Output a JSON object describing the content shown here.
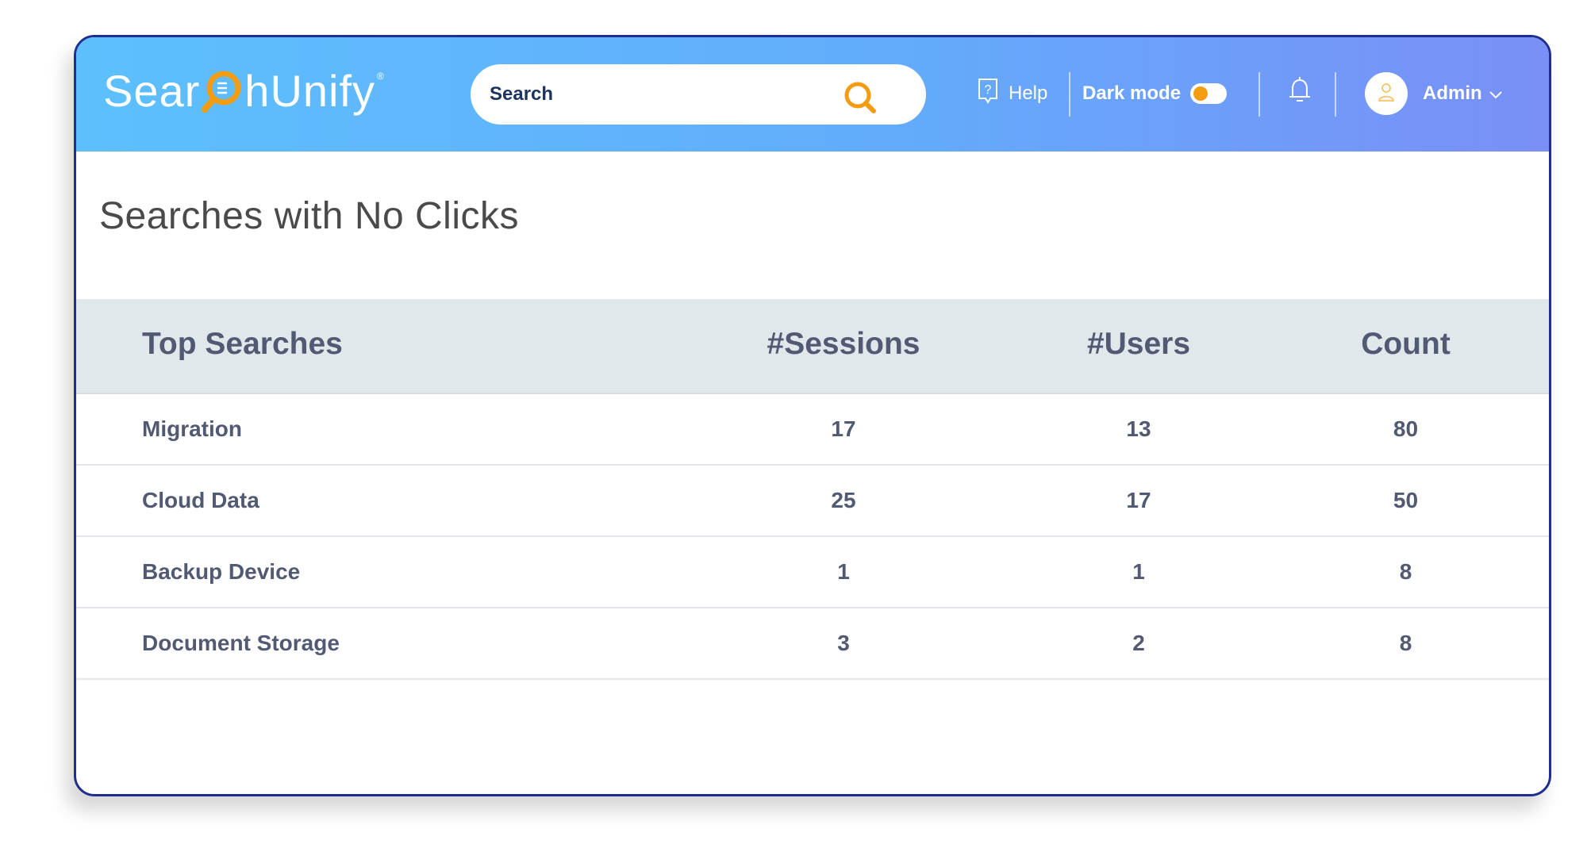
{
  "app": {
    "logo_text_before": "Sear",
    "logo_text_after": "hUnify",
    "logo_reg": "®"
  },
  "header": {
    "search_placeholder": "Search",
    "help_label": "Help",
    "dark_mode_label": "Dark mode",
    "dark_mode_enabled": false,
    "user_label": "Admin"
  },
  "icons": {
    "search": "search-icon",
    "help": "help-icon",
    "bell": "bell-icon",
    "user": "user-icon",
    "chevron": "chevron-down-icon"
  },
  "colors": {
    "header_gradient_start": "#5dc0fd",
    "header_gradient_end": "#7a8ff7",
    "accent_orange": "#f39c12",
    "card_border": "#1e2f8f",
    "table_header_bg": "#e1e8ec",
    "text_primary": "#525a73"
  },
  "page": {
    "title": "Searches with No Clicks"
  },
  "table": {
    "columns": [
      "Top Searches",
      "#Sessions",
      "#Users",
      "Count"
    ],
    "rows": [
      {
        "search": "Migration",
        "sessions": "17",
        "users": "13",
        "count": "80"
      },
      {
        "search": "Cloud Data",
        "sessions": "25",
        "users": "17",
        "count": "50"
      },
      {
        "search": "Backup Device",
        "sessions": "1",
        "users": "1",
        "count": "8"
      },
      {
        "search": "Document Storage",
        "sessions": "3",
        "users": "2",
        "count": "8"
      }
    ]
  }
}
